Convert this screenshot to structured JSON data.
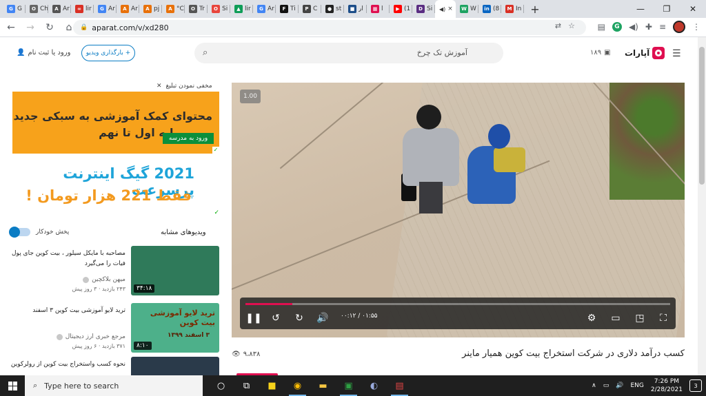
{
  "browser": {
    "tabs": [
      {
        "letter": "G",
        "label": "G",
        "color": "#4285f4"
      },
      {
        "letter": "O",
        "label": "Ch",
        "color": "#666"
      },
      {
        "letter": "A",
        "label": "Ar",
        "color": "#555"
      },
      {
        "letter": "∞",
        "label": "lir",
        "color": "#d93025"
      },
      {
        "letter": "G",
        "label": "Ar",
        "color": "#4285f4"
      },
      {
        "letter": "A",
        "label": "Ar",
        "color": "#e8710a"
      },
      {
        "letter": "A",
        "label": "pj",
        "color": "#e8710a"
      },
      {
        "letter": "A",
        "label": "°C",
        "color": "#e8710a"
      },
      {
        "letter": "O",
        "label": "Tr",
        "color": "#555"
      },
      {
        "letter": "O",
        "label": "Si",
        "color": "#e8453c"
      },
      {
        "letter": "▲",
        "label": "lir",
        "color": "#0f9d58"
      },
      {
        "letter": "G",
        "label": "Ar",
        "color": "#4285f4"
      },
      {
        "letter": "F",
        "label": "Ti",
        "color": "#111"
      },
      {
        "letter": "P",
        "label": "C",
        "color": "#444"
      },
      {
        "letter": "●",
        "label": "st",
        "color": "#222"
      },
      {
        "letter": "■",
        "label": "آر",
        "color": "#1d4e89"
      },
      {
        "letter": "▦",
        "label": "آ",
        "color": "#df0f50"
      },
      {
        "letter": "▶",
        "label": "(1",
        "color": "#ff0000"
      },
      {
        "letter": "D",
        "label": "Si",
        "color": "#5a2d82"
      }
    ],
    "active_tab_close": "×",
    "more_tabs": [
      {
        "letter": "W",
        "label": "W",
        "color": "#1ea362"
      },
      {
        "letter": "in",
        "label": "(8",
        "color": "#0a66c2"
      },
      {
        "letter": "M",
        "label": "In",
        "color": "#d93025"
      }
    ],
    "new_tab": "+",
    "url": "aparat.com/v/xd280",
    "win_minimize": "—",
    "win_restore": "❐",
    "win_close": "✕"
  },
  "site": {
    "brand": "آپارات",
    "notif_count": "۱۸۹",
    "search_query": "آموزش تک چرخ",
    "upload_label": "بارگذاری ویدیو",
    "upload_plus": "+",
    "login_label": "ورود یا ثبت نام"
  },
  "player": {
    "speed": "1.00",
    "time": "۰۰:۱۲ / ۰۱:۵۵",
    "progress_fraction": 0.11
  },
  "video": {
    "title": "کسب درآمد دلاری در شرکت استخراج بیت کوین همیار ماینر",
    "views": "۹،۸۳۸"
  },
  "sidebar": {
    "hide_ad": "مخفی نمودن تبلیغ",
    "ad1": {
      "line1": "محتوای کمک آموزشی به سبکی جدید",
      "line2": "پایه اول تا نهم",
      "cta": "ورود به مدرسه"
    },
    "ad2": {
      "line1": "2021 گیگ اینترنت پرسرعت",
      "line2": "فقط 221 هزار تومان !"
    },
    "similar_heading": "ویدیوهای مشابه",
    "autoplay_label": "پخش خودکار",
    "recommendations": [
      {
        "title": "مصاحبه با مایکل سیلور ، بیت کوین جای پول فیات را می‌گیرد",
        "channel": "میهن بلاکچین",
        "meta": "۲۴۳ بازدید  ·  ۳ روز پیش",
        "duration": "۳۴:۱۸",
        "thumb_color": "#2f7a5a"
      },
      {
        "title": "ترید لایو آموزشی بیت کوین ۳ اسفند",
        "channel": "مرجع خبری ارز دیجیتال",
        "meta": "۳۷۱ بازدید  ·  ۶ روز پیش",
        "duration": "۸:۱۰",
        "thumb_color": "#4db08a",
        "thumb_text": "ترید لایو آموزشی بیت کوین",
        "thumb_sub": "۳ اسفند ۱۳۹۹"
      },
      {
        "title": "نحوه کسب واستخراج بیت کوین از رولرکوین",
        "channel": "",
        "meta": "",
        "duration": "",
        "thumb_color": "#2a3a4a"
      }
    ]
  },
  "taskbar": {
    "search_placeholder": "Type here to search",
    "lang": "ENG",
    "time": "7:26 PM",
    "date": "2/28/2021",
    "notif_count": "3"
  }
}
